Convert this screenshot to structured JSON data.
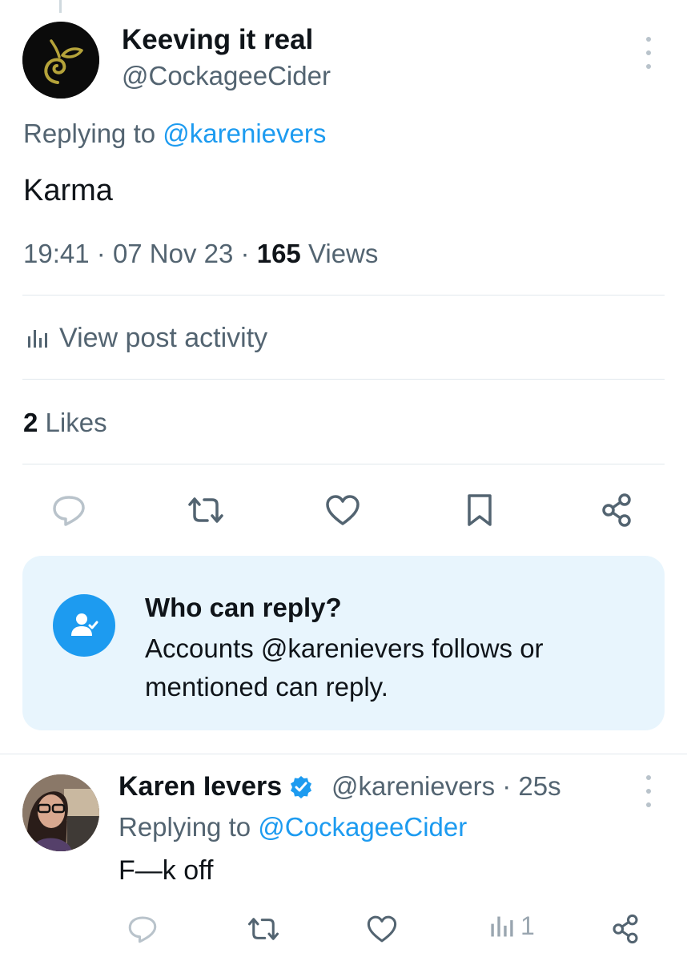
{
  "tweet": {
    "author_name": "Keeving it real",
    "author_handle": "@CockageeCider",
    "replying_prefix": "Replying to",
    "replying_handle": "@karenievers",
    "text": "Karma",
    "time": "19:41",
    "date": "07 Nov 23",
    "views_count": "165",
    "views_label": "Views",
    "activity_label": "View post activity",
    "likes_count": "2",
    "likes_label": "Likes"
  },
  "who_can_reply": {
    "title": "Who can reply?",
    "body": "Accounts @karenievers follows or mentioned can reply."
  },
  "reply": {
    "author_name": "Karen Ievers",
    "author_handle": "@karenievers",
    "age": "25s",
    "replying_prefix": "Replying to",
    "replying_handle": "@CockageeCider",
    "text": "F—k off",
    "views_count": "1"
  },
  "icons": [
    "more-icon",
    "reply-icon",
    "retweet-icon",
    "like-icon",
    "bookmark-icon",
    "share-icon",
    "analytics-icon",
    "verified-icon",
    "user-check-icon"
  ],
  "colors": {
    "accent": "#1d9bf0",
    "secondary_text": "#536471",
    "primary_text": "#0f1419",
    "panel_bg": "#e8f5fd"
  }
}
